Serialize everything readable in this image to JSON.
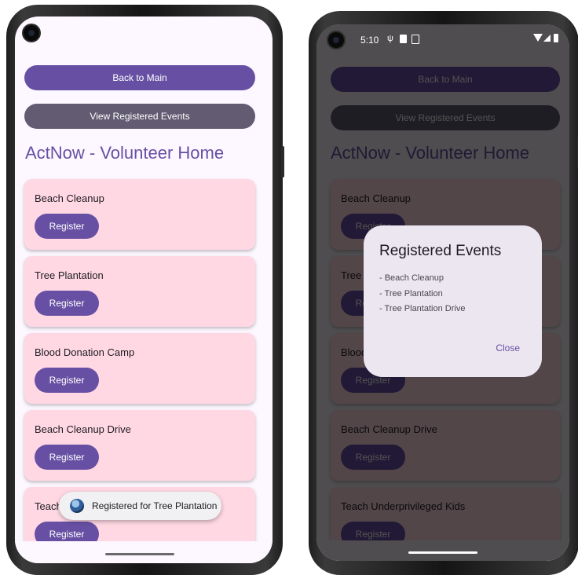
{
  "app": {
    "back_label": "Back to Main",
    "view_label": "View Registered Events",
    "title": "ActNow - Volunteer Home",
    "register_label": "Register"
  },
  "events": [
    {
      "name": "Beach Cleanup"
    },
    {
      "name": "Tree Plantation"
    },
    {
      "name": "Blood Donation Camp"
    },
    {
      "name": "Beach Cleanup Drive"
    },
    {
      "name": "Teach Underprivileged Kids"
    }
  ],
  "left_phone": {
    "toast": {
      "text": "Registered for Tree Plantation",
      "icon": "app-logo-icon"
    }
  },
  "right_phone": {
    "status_bar": {
      "time": "5:10",
      "icons": [
        "usb-icon",
        "sd-card-icon",
        "screenshot-icon",
        "wifi-icon",
        "signal-icon",
        "battery-icon"
      ]
    },
    "dialog": {
      "title": "Registered Events",
      "items": [
        "- Beach Cleanup",
        "- Tree Plantation",
        "- Tree Plantation Drive"
      ],
      "close_label": "Close"
    }
  },
  "colors": {
    "primary": "#6750a4",
    "secondary": "#625b71",
    "card": "#ffd8e4",
    "background": "#fdf7ff",
    "dialog": "#ece6f0"
  }
}
